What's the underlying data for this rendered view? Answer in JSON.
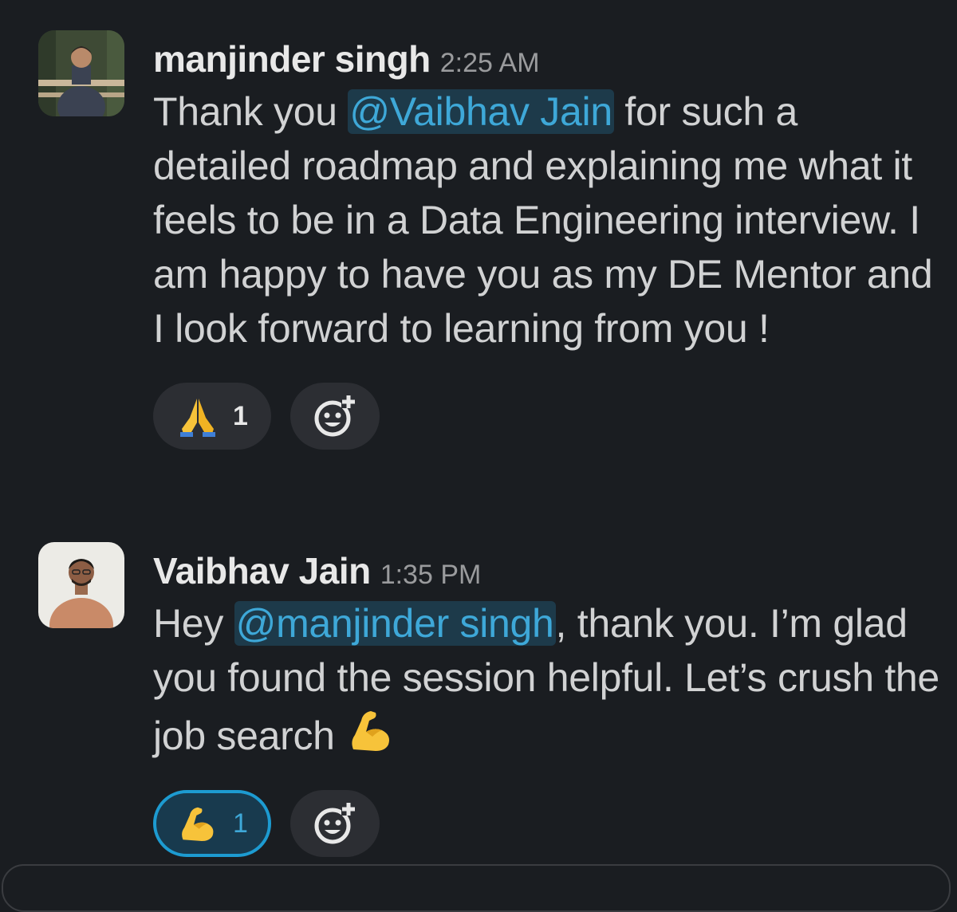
{
  "messages": [
    {
      "author": "manjinder singh",
      "time": "2:25 AM",
      "text_before": "Thank you ",
      "mention": "@Vaibhav Jain",
      "text_after": " for such a detailed roadmap and explaining me what it feels to be in a Data Engineering interview. I am happy to have you as my DE Mentor and I look forward to learning from you !",
      "reactions": [
        {
          "emoji": "folded-hands-icon",
          "count": "1",
          "active": false
        }
      ]
    },
    {
      "author": "Vaibhav Jain",
      "time": "1:35 PM",
      "text_before": "Hey ",
      "mention": "@manjinder singh",
      "text_after": ", thank you. I’m glad you found the session helpful. Let’s crush the job search ",
      "inline_emoji": "flexed-biceps-icon",
      "reactions": [
        {
          "emoji": "flexed-biceps-icon",
          "count": "1",
          "active": true
        }
      ]
    }
  ],
  "colors": {
    "background": "#1a1d21",
    "mention_text": "#3ea8d8",
    "mention_bg": "#1d3a4a",
    "active_reaction_border": "#1d9bd1"
  }
}
